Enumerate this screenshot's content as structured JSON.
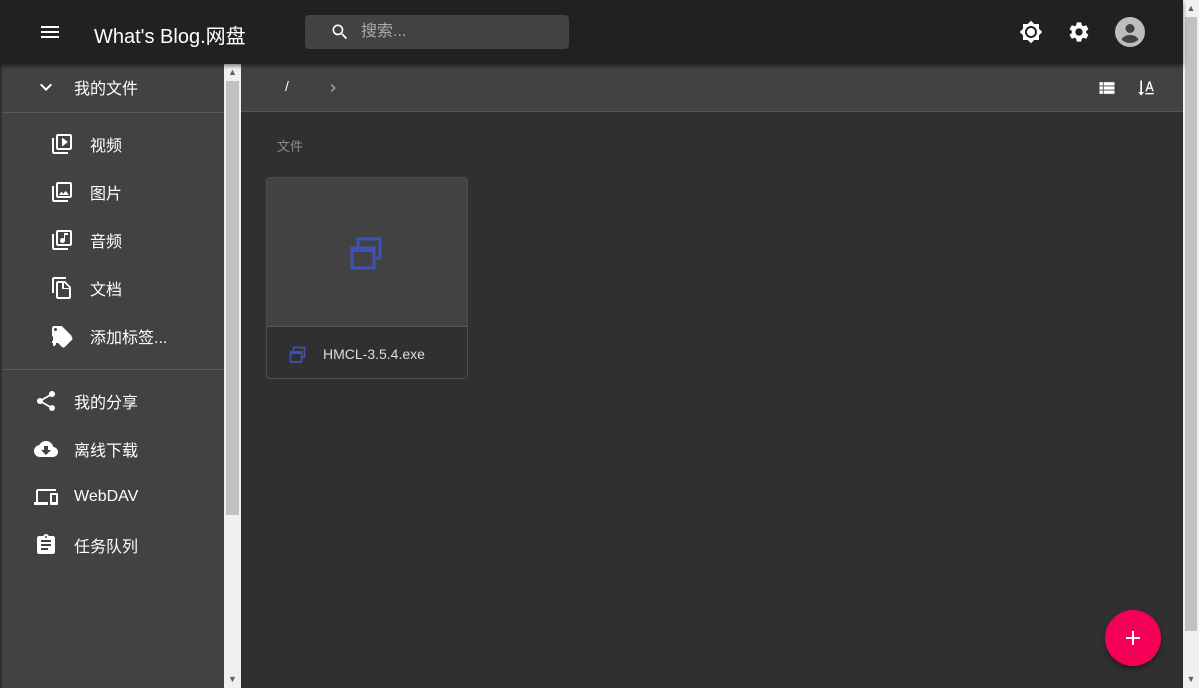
{
  "appbar": {
    "title": "What's Blog.网盘",
    "search_placeholder": "搜索..."
  },
  "sidebar": {
    "my_files": "我的文件",
    "file_types": [
      {
        "icon": "video-library-icon",
        "label": "视频"
      },
      {
        "icon": "image-library-icon",
        "label": "图片"
      },
      {
        "icon": "music-library-icon",
        "label": "音频"
      },
      {
        "icon": "document-copy-icon",
        "label": "文档"
      },
      {
        "icon": "tag-add-icon",
        "label": "添加标签..."
      }
    ],
    "items": [
      {
        "icon": "share-icon",
        "label": "我的分享"
      },
      {
        "icon": "cloud-download-icon",
        "label": "离线下载"
      },
      {
        "icon": "devices-icon",
        "label": "WebDAV"
      },
      {
        "icon": "clipboard-icon",
        "label": "任务队列"
      }
    ]
  },
  "navbar": {
    "path_root": "/"
  },
  "main": {
    "section_label": "文件",
    "files": [
      {
        "name": "HMCL-3.5.4.exe",
        "icon": "executable-file-icon"
      }
    ]
  },
  "colors": {
    "appbar": "#212121",
    "sidebar": "#424242",
    "content": "#303030",
    "fab": "#f50057",
    "file_icon": "#3f51b5"
  }
}
